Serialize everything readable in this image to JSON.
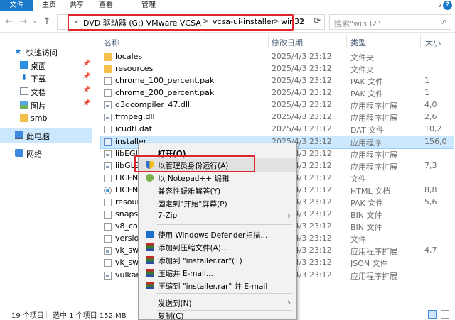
{
  "ribbon": {
    "tabs": [
      "文件",
      "主页",
      "共享",
      "查看",
      "管理"
    ],
    "tools_label": "∨",
    "help": "?"
  },
  "address": {
    "prefix": "«",
    "crumbs": [
      "DVD 驱动器 (G:) VMware VCSA",
      "vcsa-ui-installer",
      "win32"
    ],
    "separator": ">",
    "search_placeholder": "搜索\"win32\""
  },
  "sidebar": {
    "items": [
      {
        "label": "快速访问",
        "icon": "star-icon"
      },
      {
        "label": "桌面",
        "icon": "desktop-icon",
        "pinned": true
      },
      {
        "label": "下载",
        "icon": "download-icon",
        "pinned": true
      },
      {
        "label": "文档",
        "icon": "document-icon",
        "pinned": true
      },
      {
        "label": "图片",
        "icon": "picture-icon",
        "pinned": true
      },
      {
        "label": "smb",
        "icon": "folder-icon"
      },
      {
        "label": "此电脑",
        "icon": "computer-icon"
      },
      {
        "label": "网络",
        "icon": "network-icon"
      }
    ]
  },
  "columns": {
    "name": "名称",
    "date": "修改日期",
    "type": "类型",
    "size": "大小"
  },
  "files": [
    {
      "name": "locales",
      "date": "2025/4/3 23:12",
      "type": "文件夹",
      "size": "",
      "icon": "folder"
    },
    {
      "name": "resources",
      "date": "2025/4/3 23:12",
      "type": "文件夹",
      "size": "",
      "icon": "folder"
    },
    {
      "name": "chrome_100_percent.pak",
      "date": "2025/4/3 23:12",
      "type": "PAK 文件",
      "size": "1",
      "icon": "file"
    },
    {
      "name": "chrome_200_percent.pak",
      "date": "2025/4/3 23:12",
      "type": "PAK 文件",
      "size": "1",
      "icon": "file"
    },
    {
      "name": "d3dcompiler_47.dll",
      "date": "2025/4/3 23:12",
      "type": "应用程序扩展",
      "size": "4,0",
      "icon": "dll"
    },
    {
      "name": "ffmpeg.dll",
      "date": "2025/4/3 23:12",
      "type": "应用程序扩展",
      "size": "2,6",
      "icon": "dll"
    },
    {
      "name": "icudtl.dat",
      "date": "2025/4/3 23:12",
      "type": "DAT 文件",
      "size": "10,2",
      "icon": "file"
    },
    {
      "name": "installer",
      "date": "2025/4/3 23:12",
      "type": "应用程序",
      "size": "156,0",
      "icon": "exe"
    },
    {
      "name": "libEGL",
      "date": "2025/4/3 23:12",
      "type": "应用程序扩展",
      "size": "",
      "icon": "dll"
    },
    {
      "name": "libGLES",
      "date": "2025/4/3 23:12",
      "type": "应用程序扩展",
      "size": "7,3",
      "icon": "dll"
    },
    {
      "name": "LICENS",
      "date": "2025/4/3 23:12",
      "type": "文件",
      "size": "",
      "icon": "file"
    },
    {
      "name": "LICENS",
      "date": "2025/4/3 23:12",
      "type": "HTML 文档",
      "size": "8,8",
      "icon": "html"
    },
    {
      "name": "resourc",
      "date": "2025/4/3 23:12",
      "type": "PAK 文件",
      "size": "5,6",
      "icon": "file"
    },
    {
      "name": "snapsh",
      "date": "2025/4/3 23:12",
      "type": "BIN 文件",
      "size": "",
      "icon": "file"
    },
    {
      "name": "v8_con",
      "date": "2025/4/3 23:12",
      "type": "BIN 文件",
      "size": "",
      "icon": "file"
    },
    {
      "name": "version",
      "date": "2025/4/3 23:12",
      "type": "文件",
      "size": "",
      "icon": "file"
    },
    {
      "name": "vk_swif",
      "date": "2025/4/3 23:12",
      "type": "应用程序扩展",
      "size": "4,7",
      "icon": "dll"
    },
    {
      "name": "vk_swif",
      "date": "2025/4/3 23:12",
      "type": "JSON 文件",
      "size": "",
      "icon": "file"
    },
    {
      "name": "vulkan-",
      "date": "2025/4/3 23:12",
      "type": "应用程序扩展",
      "size": "",
      "icon": "dll"
    }
  ],
  "status": {
    "count": "19 个项目",
    "selected": "选中 1 个项目  152 MB"
  },
  "context_menu": {
    "items": [
      {
        "label": "打开(O)",
        "bold": true
      },
      {
        "label": "以管理员身份运行(A)",
        "icon": "shield-icon",
        "highlighted": true
      },
      {
        "label": "以 Notepad++ 编辑",
        "icon": "notepad-plus-plus-icon"
      },
      {
        "label": "兼容性疑难解答(Y)"
      },
      {
        "label": "固定到\"开始\"屏幕(P)"
      },
      {
        "label": "7-Zip",
        "submenu": true
      },
      {
        "label": "使用 Windows Defender扫描...",
        "icon": "defender-icon"
      },
      {
        "label": "添加到压缩文件(A)...",
        "icon": "winrar-icon"
      },
      {
        "label": "添加到 \"installer.rar\"(T)",
        "icon": "winrar-icon"
      },
      {
        "label": "压缩并 E-mail...",
        "icon": "winrar-icon"
      },
      {
        "label": "压缩到 \"installer.rar\" 并 E-mail",
        "icon": "winrar-icon"
      },
      {
        "label": "发送到(N)",
        "submenu": true
      },
      {
        "label": "复制(C)"
      }
    ]
  },
  "colors": {
    "file_tab": "#1979ca",
    "selection": "#cce8ff",
    "annotation": "#e0262d"
  }
}
